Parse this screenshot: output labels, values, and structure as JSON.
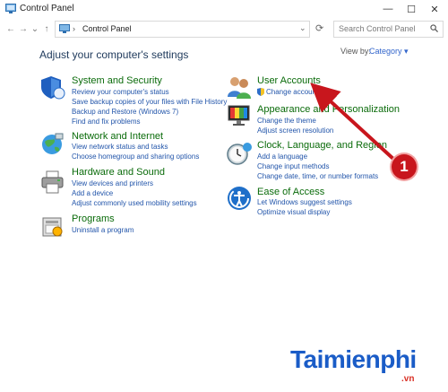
{
  "window": {
    "title": "Control Panel",
    "controls": {
      "minimize": "—",
      "maximize": "☐",
      "close": "✕"
    }
  },
  "address": {
    "path": "Control Panel",
    "search_placeholder": "Search Control Panel"
  },
  "header": {
    "title": "Adjust your computer's settings",
    "view_by_label": "View by:",
    "view_by_value": "Category ▾"
  },
  "categories_left": [
    {
      "title": "System and Security",
      "links": [
        "Review your computer's status",
        "Save backup copies of your files with File History",
        "Backup and Restore (Windows 7)",
        "Find and fix problems"
      ]
    },
    {
      "title": "Network and Internet",
      "links": [
        "View network status and tasks",
        "Choose homegroup and sharing options"
      ]
    },
    {
      "title": "Hardware and Sound",
      "links": [
        "View devices and printers",
        "Add a device",
        "Adjust commonly used mobility settings"
      ]
    },
    {
      "title": "Programs",
      "links": [
        "Uninstall a program"
      ]
    }
  ],
  "categories_right": [
    {
      "title": "User Accounts",
      "links": [
        "Change account ty"
      ]
    },
    {
      "title": "Appearance and Personalization",
      "links": [
        "Change the theme",
        "Adjust screen resolution"
      ]
    },
    {
      "title": "Clock, Language, and Region",
      "links": [
        "Add a language",
        "Change input methods",
        "Change date, time, or number formats"
      ]
    },
    {
      "title": "Ease of Access",
      "links": [
        "Let Windows suggest settings",
        "Optimize visual display"
      ]
    }
  ],
  "annotation": {
    "badge": "1"
  },
  "watermark": {
    "brand": "Taimienphi",
    "tld": ".vn"
  },
  "colors": {
    "title_green": "#0a6b0a",
    "link_blue": "#2255aa",
    "badge_red": "#c8161d",
    "brand_blue": "#1a5cc7"
  }
}
